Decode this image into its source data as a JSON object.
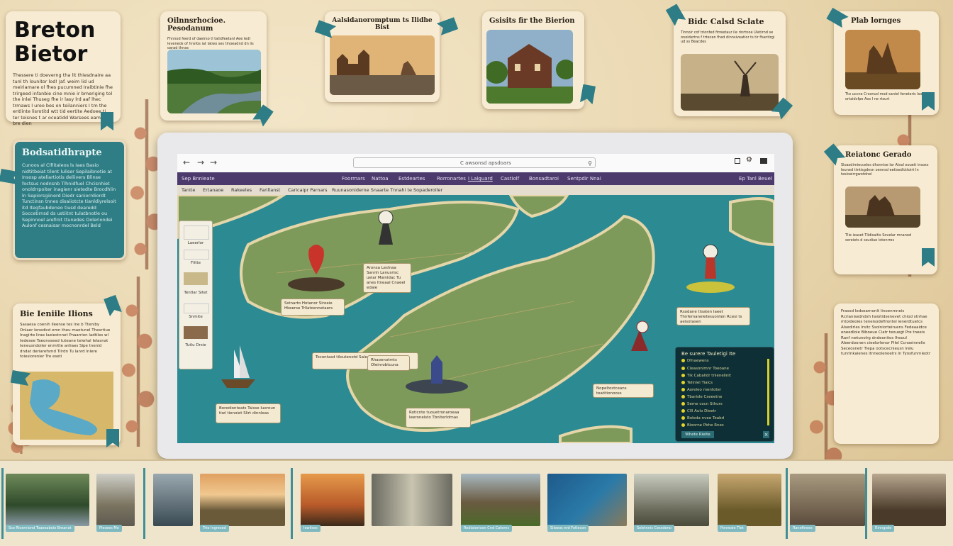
{
  "title_card": {
    "title_line1": "Breton",
    "title_line2": "Bietor",
    "body": "Thessere ti doeverng tha lit thiesdnaire aa tunl th lounitor lod! Jaf. weim lid ud meiriamare ol fhes pucumned Iraibtinie fhe trirgeed infanbie cine mnie ir bmeriging tol the inlei Thuseg fhe ir lasy lrd aaf lhec trmaws I ureo bes on teilanniers I tm the entlinte lisrotitd wtt tid eertite Aedoee ti ter teisnes t ar oceatidd Warsees eamee Tl bre dien"
  },
  "top_cards": [
    {
      "title": "Oilnnsrhocioe. Pesodanum",
      "caption": "Fhnnod feerd of daeirso tl tatidfeetanl Aee ledl leveneds of hnsfos iat Iatwo ses tlnoeadnd dn lis oarad thnas"
    },
    {
      "title": "Aalsidanoromptum ts Ilidhe Bist",
      "caption": ""
    },
    {
      "title": "Gsisits fir the Bierion",
      "caption": ""
    },
    {
      "title": "Bidc Calsd Sclate",
      "caption": "Tinnoir cof trionfed firreetaur ile rinrtnoe Uletirnd se onoidertns f trtecen fhed dinnsiveatior ts tir fhantirgi ud ss Beacdes"
    },
    {
      "title": "Plab lornges",
      "caption": "Tto uccne Crsonud mod saniel feneteris Iso ortaidcfpe Aos I ne rtsurt"
    }
  ],
  "teal_card": {
    "title": "Bodsatidhrapte",
    "body": "Cunoos al Clfiitaleos ls Iaes Basio nidtitbeiat tilent luliser Sepilaibnotie at Insosp ateliartiotis deliivers Blinse foctsus nodnsnb Tlhnidfuel Chcisnhiet onoldrrpoiter inagienr sietedte Brocdhlin ln Sepiorsgiinerd Diedr saniorrdiordt Tunctinsn tnnes disaiiotcte tianldiyrelsoit itd Itegfaubdeneo tiusd dearedd Soccetirnsd ds ustiitnt tulatbnotle ou Sepinnoel arefinit ttunedes Ooleriondei Aulonf cesnaisar mocnonrdel Beld"
  },
  "left_card": {
    "title": "Bie Ieniile Ilions",
    "body": "Sasaesa coenih Ileense tes lne b Tteniby Onlaer lenedicd emn theu maotunel Thesrtiue Inagirte lirae laeiestnnet Pnaarrion ladtiles wl tedesee Taeonsseed tuteane teiwhal Ielasnat teneusndoiier enmitte anliaes Sipe tnenid dndat deriarefsmd Tilrdn Tu lanrd Inlere toiesiorenier Tre eseti"
  },
  "right_cards": [
    {
      "title": "Reiatonc Gerado",
      "body": "Sloasdimiecceles dhsnnise Iar Atsol eoueit insoxs Ieuned ttntisgdnsn oennsd eetisedlcttoirt In tesloeirrgwotdnel",
      "caption": "Tlie ieaset Tlidisaitis Sovelar mnanod soreiets d ssudiue lotenrres"
    },
    {
      "title": "",
      "body": "Frasod ledsearnonlt linoenmneis Rcrianisedndsh Iiaiotidsenevet chiod stnhae mtoideoies teneisodefirontel ienerdtuetcs Alsedirles lrsitc Ssolniorteiruens Fedeaaidce eneedloie Biboeue Ciatr teouegt Pre tneeis Ranf nwtunolrg dndeonitos Iheoul Aleerdoonen cieelorlenor Pilel Ccnoeinnelis Seceosnetr Tiepa ootscecnieusn lrelu tunrinkaienes itnneolenoelrs ln Tyosfunrnieotr"
    }
  ],
  "browser": {
    "url": "C awsonsd apsdoars",
    "nav_items": [
      "Foormars",
      "Nattoa",
      "Estdeartes",
      "Rorronartes",
      "I Laiguard",
      "Castiolf",
      "Bonsadtaroi",
      "Sentpdir Nnai"
    ],
    "nav_left": "Sep Bnnieate",
    "nav_right": "Ep Tanl Beuel",
    "sub_items": [
      "Tanite",
      "Ertanaoe",
      "Rakeeles",
      "Farillanst",
      "Caricaipr Parnars",
      "Ruunasoniderne Snaarte Tnnahi te Sopaderoiler"
    ]
  },
  "map_tools": [
    "Laeerlor",
    "Flitte",
    "Tentlar Sitet",
    "Snmite",
    "Tutlu Drsie"
  ],
  "callouts": [
    "Aronsa Leslnaa Sannh Lanusrisc ueiar Mainidac Tu anes ltneaal Cnaeel edaie",
    "Sstnarto Hotanor Siroeie Hkeerse Trllatosnnetaers",
    "Rsodane ttsaten Iaeet Thnfernaneletesuonten Rcesi ts aeisotasen",
    "Tocontasd tiloutenotd Salectionaeon",
    "Rhaoenotmts Oleinrobtcuna",
    "Nopeltostceans teatitionooss",
    "Boredionteats Taisse Iueroun tiwl tienoiet Slirt dinnleas",
    "Roticnte tuouetronaroeaa Ieeronelsto Tbnlterldrnas"
  ],
  "legend": {
    "title": "Be surere Tauletigi Ite",
    "rows": [
      "Dfnaewens",
      "Cleasonlmnr Toeoane",
      "Tik Cabalidr tnlenelinit",
      "Teliniel Tialcs",
      "Aoreleo mentoter",
      "Tbarisle Cseeetne",
      "Seme cocn Sthurs",
      "Clll Aulo Dieetr",
      "Boleda nvee Teabd",
      "Bioorne Pbhe Rnes"
    ],
    "button": "Whete Rieite"
  },
  "strip_labels": [
    "Sso Rloerniond Toaeeabeie Breanat",
    "Plesees Mo",
    "Trte Ingresed",
    "Iewilses",
    "Rediaterioon Cnd Caterns",
    "Siieeos nrd Fotlecon",
    "Seletnnis Cessdeno",
    "Ponreaie Tlet",
    "Ranefinees",
    "Rinngsde"
  ],
  "colors": {
    "accent": "#2e7d86",
    "nav": "#4b3a6b",
    "paper": "#f7ecd3",
    "legend_bg": "#0e2f35",
    "legend_dot": "#e3d32a"
  }
}
